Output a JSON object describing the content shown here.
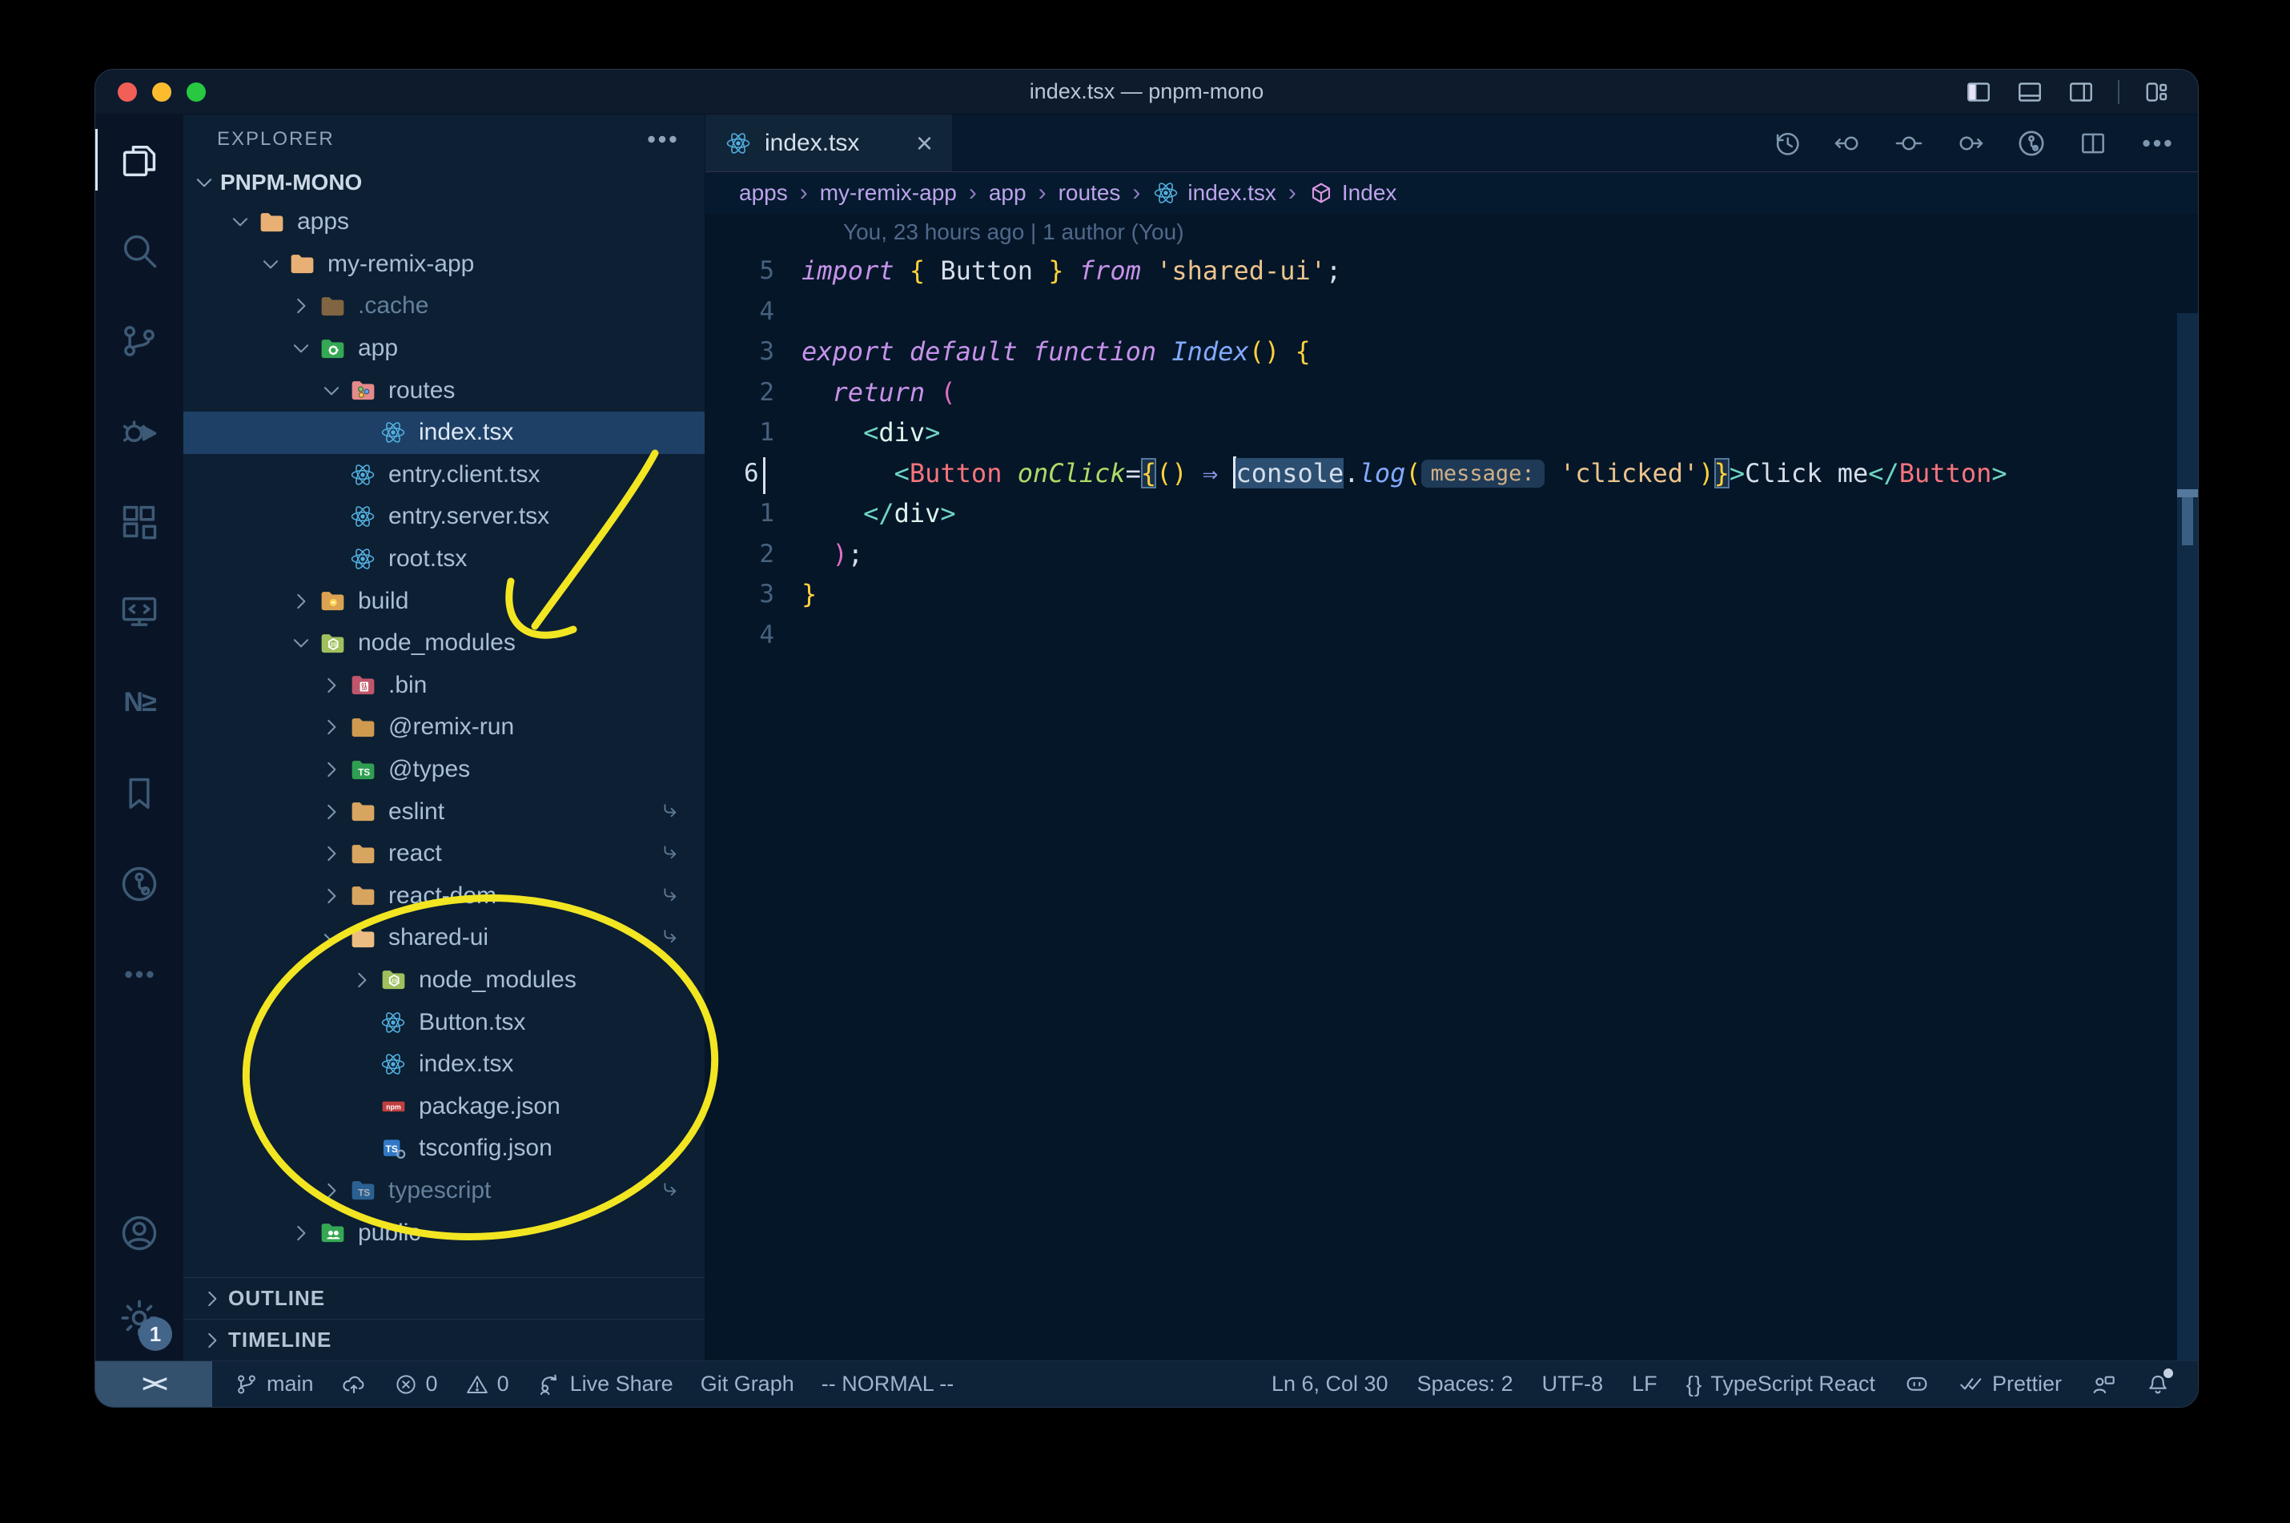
{
  "window": {
    "title": "index.tsx — pnpm-mono"
  },
  "titlebar": {
    "controls": [
      {
        "id": "toggle-primary-sidebar",
        "icon": "layout-sidebar-left-icon"
      },
      {
        "id": "toggle-panel",
        "icon": "layout-panel-icon"
      },
      {
        "id": "toggle-secondary-sidebar",
        "icon": "layout-sidebar-right-icon"
      },
      {
        "id": "separator",
        "icon": "separator"
      },
      {
        "id": "customize-layout",
        "icon": "customize-layout-icon"
      }
    ]
  },
  "activity_bar": {
    "top": [
      {
        "id": "explorer",
        "icon": "explorer-icon",
        "active": true
      },
      {
        "id": "search",
        "icon": "search-icon"
      },
      {
        "id": "source-control",
        "icon": "source-control-icon"
      },
      {
        "id": "run-debug",
        "icon": "debug-icon"
      },
      {
        "id": "extensions",
        "icon": "extensions-icon"
      },
      {
        "id": "remote-explorer",
        "icon": "remote-explorer-icon"
      },
      {
        "id": "nx-console",
        "icon": "nx-icon"
      },
      {
        "id": "bookmarks",
        "icon": "bookmarks-icon"
      },
      {
        "id": "gitlens",
        "icon": "gitlens-icon"
      },
      {
        "id": "more-views",
        "icon": "ellipsis-icon"
      }
    ],
    "bottom": [
      {
        "id": "account",
        "icon": "account-icon"
      },
      {
        "id": "settings",
        "icon": "gear-icon",
        "badge": "1"
      }
    ]
  },
  "sidebar": {
    "header": "EXPLORER",
    "section": {
      "label": "PNPM-MONO",
      "expanded": true
    },
    "tree": [
      {
        "label": "apps",
        "icon": "folder",
        "color": "#e8b074",
        "level": 1,
        "chevron": "down"
      },
      {
        "label": "my-remix-app",
        "icon": "folder",
        "color": "#e8b074",
        "level": 2,
        "chevron": "down"
      },
      {
        "label": ".cache",
        "icon": "folder",
        "color": "#c08a4a",
        "level": 3,
        "chevron": "right",
        "dimmed": true
      },
      {
        "label": "app",
        "icon": "folder-app",
        "color": "#35a854",
        "level": 3,
        "chevron": "down"
      },
      {
        "label": "routes",
        "icon": "folder-routes",
        "color": "#e58a8a",
        "level": 4,
        "chevron": "down"
      },
      {
        "label": "index.tsx",
        "icon": "react-icon",
        "level": 5,
        "file": true,
        "selected": true
      },
      {
        "label": "entry.client.tsx",
        "icon": "react-icon",
        "level": 4,
        "file": true
      },
      {
        "label": "entry.server.tsx",
        "icon": "react-icon",
        "level": 4,
        "file": true
      },
      {
        "label": "root.tsx",
        "icon": "react-icon",
        "level": 4,
        "file": true
      },
      {
        "label": "build",
        "icon": "folder-dist",
        "color": "#dca253",
        "level": 3,
        "chevron": "right"
      },
      {
        "label": "node_modules",
        "icon": "folder-nm",
        "color": "#9fc05c",
        "level": 3,
        "chevron": "down"
      },
      {
        "label": ".bin",
        "icon": "folder-bin",
        "color": "#c0566b",
        "level": 4,
        "chevron": "right"
      },
      {
        "label": "@remix-run",
        "icon": "folder",
        "color": "#cf9a50",
        "level": 4,
        "chevron": "right"
      },
      {
        "label": "@types",
        "icon": "folder-ts",
        "color": "#2f9e52",
        "level": 4,
        "chevron": "right"
      },
      {
        "label": "eslint",
        "icon": "folder",
        "color": "#d8a560",
        "level": 4,
        "chevron": "right",
        "symlink": true
      },
      {
        "label": "react",
        "icon": "folder",
        "color": "#d8a560",
        "level": 4,
        "chevron": "right",
        "symlink": true
      },
      {
        "label": "react-dom",
        "icon": "folder",
        "color": "#d8a560",
        "level": 4,
        "chevron": "right",
        "symlink": true
      },
      {
        "label": "shared-ui",
        "icon": "folder",
        "color": "#ecbd82",
        "level": 4,
        "chevron": "down",
        "symlink": true
      },
      {
        "label": "node_modules",
        "icon": "folder-nm",
        "color": "#9fc05c",
        "level": 5,
        "chevron": "right"
      },
      {
        "label": "Button.tsx",
        "icon": "react-icon",
        "level": 5,
        "file": true
      },
      {
        "label": "index.tsx",
        "icon": "react-icon",
        "level": 5,
        "file": true
      },
      {
        "label": "package.json",
        "icon": "npm-icon",
        "level": 5,
        "file": true
      },
      {
        "label": "tsconfig.json",
        "icon": "tsconfig-icon",
        "level": 5,
        "file": true
      },
      {
        "label": "typescript",
        "icon": "folder-tsblue",
        "color": "#3d84c6",
        "level": 4,
        "chevron": "right",
        "symlink": true,
        "dimmed": true
      },
      {
        "label": "public",
        "icon": "folder-public",
        "color": "#35a854",
        "level": 3,
        "chevron": "right"
      }
    ],
    "panels": [
      {
        "label": "OUTLINE"
      },
      {
        "label": "TIMELINE"
      }
    ]
  },
  "editor": {
    "tab": {
      "label": "index.tsx",
      "icon": "react-icon",
      "close": "×"
    },
    "actions": [
      {
        "id": "timeline-history",
        "icon": "history-icon"
      },
      {
        "id": "previous-change",
        "icon": "prev-change-icon"
      },
      {
        "id": "current-change",
        "icon": "change-icon"
      },
      {
        "id": "next-change",
        "icon": "next-change-icon"
      },
      {
        "id": "gitlens-graph",
        "icon": "gitlens-graph-icon"
      },
      {
        "id": "split-editor",
        "icon": "split-editor-icon"
      },
      {
        "id": "more-actions",
        "icon": "ellipsis-icon"
      }
    ],
    "breadcrumbs": [
      {
        "label": "apps"
      },
      {
        "label": "my-remix-app"
      },
      {
        "label": "app"
      },
      {
        "label": "routes"
      },
      {
        "label": "index.tsx",
        "icon": "react-icon"
      },
      {
        "label": "Index",
        "icon": "symbol-cube-icon"
      }
    ],
    "blame": "You, 23 hours ago | 1 author (You)",
    "lines": [
      {
        "num": "5",
        "tokens": [
          {
            "t": "import",
            "c": "kw"
          },
          {
            "t": " "
          },
          {
            "t": "{",
            "c": "y"
          },
          {
            "t": " Button ",
            "c": "pl"
          },
          {
            "t": "}",
            "c": "y"
          },
          {
            "t": " "
          },
          {
            "t": "from",
            "c": "kw"
          },
          {
            "t": " "
          },
          {
            "t": "'shared-ui'",
            "c": "str"
          },
          {
            "t": ";",
            "c": "pl"
          }
        ]
      },
      {
        "num": "4",
        "tokens": []
      },
      {
        "num": "3",
        "tokens": [
          {
            "t": "export",
            "c": "kw"
          },
          {
            "t": " "
          },
          {
            "t": "default",
            "c": "kw"
          },
          {
            "t": " "
          },
          {
            "t": "function",
            "c": "kw"
          },
          {
            "t": " "
          },
          {
            "t": "Index",
            "c": "fn"
          },
          {
            "t": "()",
            "c": "y"
          },
          {
            "t": " "
          },
          {
            "t": "{",
            "c": "y"
          }
        ]
      },
      {
        "num": "2",
        "tokens": [
          {
            "t": "  "
          },
          {
            "t": "return",
            "c": "kw"
          },
          {
            "t": " "
          },
          {
            "t": "(",
            "c": "pk"
          }
        ]
      },
      {
        "num": "1",
        "tokens": [
          {
            "t": "    "
          },
          {
            "t": "<",
            "c": "tp"
          },
          {
            "t": "div",
            "c": "tag"
          },
          {
            "t": ">",
            "c": "tp"
          }
        ]
      },
      {
        "num": "6",
        "current": true,
        "tokens": [
          {
            "t": "      "
          },
          {
            "t": "<",
            "c": "tp"
          },
          {
            "t": "Button",
            "c": "comp"
          },
          {
            "t": " "
          },
          {
            "t": "onClick",
            "c": "attr"
          },
          {
            "t": "=",
            "c": "pl"
          },
          {
            "t": "{",
            "c": "ym"
          },
          {
            "t": "()",
            "c": "y"
          },
          {
            "t": " "
          },
          {
            "t": "⇒",
            "c": "arr"
          },
          {
            "t": " "
          },
          {
            "c": "cursor"
          },
          {
            "t": "console",
            "c": "word"
          },
          {
            "t": ".",
            "c": "pl"
          },
          {
            "t": "log",
            "c": "fn"
          },
          {
            "t": "(",
            "c": "y"
          },
          {
            "t": "message:",
            "c": "inlay"
          },
          {
            "t": " "
          },
          {
            "t": "'clicked'",
            "c": "str"
          },
          {
            "t": ")",
            "c": "y"
          },
          {
            "t": "}",
            "c": "ym"
          },
          {
            "t": ">",
            "c": "tp"
          },
          {
            "t": "Click me",
            "c": "pl"
          },
          {
            "t": "</",
            "c": "tp"
          },
          {
            "t": "Button",
            "c": "comp"
          },
          {
            "t": ">",
            "c": "tp"
          }
        ]
      },
      {
        "num": "1",
        "tokens": [
          {
            "t": "    "
          },
          {
            "t": "</",
            "c": "tp"
          },
          {
            "t": "div",
            "c": "tag"
          },
          {
            "t": ">",
            "c": "tp"
          }
        ]
      },
      {
        "num": "2",
        "tokens": [
          {
            "t": "  "
          },
          {
            "t": ")",
            "c": "pk"
          },
          {
            "t": ";",
            "c": "pl"
          }
        ]
      },
      {
        "num": "3",
        "tokens": [
          {
            "t": "}",
            "c": "y"
          }
        ]
      },
      {
        "num": "4",
        "tokens": []
      }
    ]
  },
  "status_bar": {
    "left": [
      {
        "id": "branch",
        "icon": "branch-icon",
        "label": "main"
      },
      {
        "id": "sync",
        "icon": "cloud-upload-icon",
        "label": ""
      },
      {
        "id": "errors",
        "icon": "error-icon",
        "label": "0"
      },
      {
        "id": "warnings",
        "icon": "warning-icon",
        "label": "0"
      },
      {
        "id": "live-share",
        "icon": "live-share-icon",
        "label": "Live Share"
      },
      {
        "id": "git-graph",
        "label": "Git Graph"
      },
      {
        "id": "vim-mode",
        "label": "-- NORMAL --"
      }
    ],
    "right": [
      {
        "id": "cursor-position",
        "label": "Ln 6, Col 30"
      },
      {
        "id": "indentation",
        "label": "Spaces: 2"
      },
      {
        "id": "encoding",
        "label": "UTF-8"
      },
      {
        "id": "eol",
        "label": "LF"
      },
      {
        "id": "language-mode",
        "icon": "braces-icon",
        "label": "TypeScript React"
      },
      {
        "id": "copilot",
        "icon": "copilot-icon",
        "label": ""
      },
      {
        "id": "prettier",
        "icon": "double-check-icon",
        "label": "Prettier"
      },
      {
        "id": "feedback",
        "icon": "feedback-icon",
        "label": ""
      },
      {
        "id": "notifications",
        "icon": "bell-icon",
        "label": ""
      }
    ],
    "remote_indicator": "><"
  },
  "annotations": {
    "color": "#f2e522",
    "arrow_meaning": "hand-drawn arrow pointing at node_modules folder",
    "ellipse_meaning": "hand-drawn ellipse circling shared-ui package contents"
  }
}
